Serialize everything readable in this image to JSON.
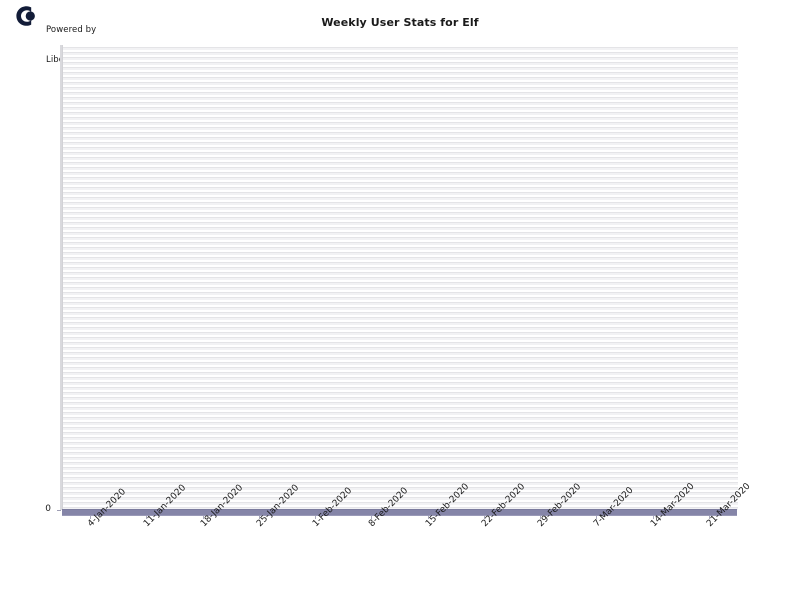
{
  "branding": {
    "logo_icon": "libchart-logo-icon",
    "line1": "Powered by",
    "line2": "Libchart"
  },
  "header": {
    "title": "Weekly User Stats for Elf"
  },
  "colors": {
    "bar": "#8585a8",
    "plot_background": "#f2f2f4",
    "gridline": "#e4e4e7",
    "text": "#1a1a1a",
    "logo": "#121c38",
    "axis": "#a8a8bb"
  },
  "chart_data": {
    "type": "bar",
    "title": "Weekly User Stats for Elf",
    "xlabel": "",
    "ylabel": "",
    "categories": [
      "4-Jan-2020",
      "11-Jan-2020",
      "18-Jan-2020",
      "25-Jan-2020",
      "1-Feb-2020",
      "8-Feb-2020",
      "15-Feb-2020",
      "22-Feb-2020",
      "29-Feb-2020",
      "7-Mar-2020",
      "14-Mar-2020",
      "21-Mar-2020"
    ],
    "values": [
      0,
      0,
      0,
      0,
      0,
      0,
      0,
      0,
      0,
      0,
      0,
      0
    ],
    "ytick_labels": [
      "0"
    ],
    "ytick_values": [
      0
    ],
    "ylim": [
      0,
      0
    ],
    "grid": true,
    "legend": false,
    "legend_position": "none"
  }
}
